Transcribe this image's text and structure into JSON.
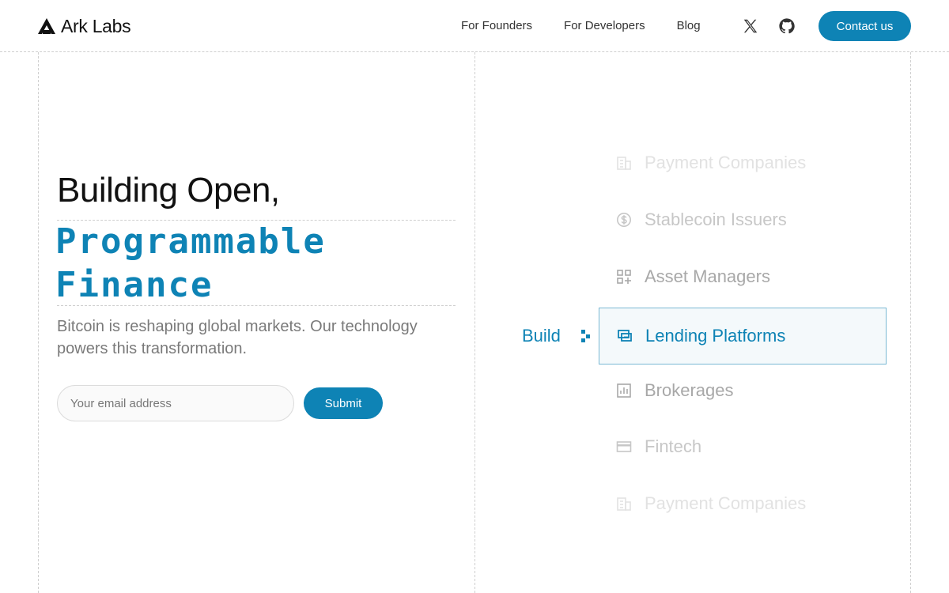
{
  "header": {
    "logo_text": "Ark Labs",
    "nav": [
      "For Founders",
      "For Developers",
      "Blog"
    ],
    "social_icons": [
      "x-twitter-icon",
      "github-icon"
    ],
    "contact_label": "Contact us"
  },
  "hero": {
    "line1": "Building Open,",
    "line2": "Programmable",
    "line3": "Finance",
    "subtitle": "Bitcoin is reshaping global markets. Our technology powers this transformation.",
    "email_placeholder": "Your email address",
    "submit_label": "Submit"
  },
  "carousel": {
    "prefix": "Build",
    "active_index": 3,
    "items": [
      {
        "label": "Payment Companies",
        "icon": "building-icon"
      },
      {
        "label": "Stablecoin Issuers",
        "icon": "dollar-circle-icon"
      },
      {
        "label": "Asset Managers",
        "icon": "grid-plus-icon"
      },
      {
        "label": "Lending Platforms",
        "icon": "cards-icon"
      },
      {
        "label": "Brokerages",
        "icon": "bar-chart-icon"
      },
      {
        "label": "Fintech",
        "icon": "credit-card-icon"
      },
      {
        "label": "Payment Companies",
        "icon": "building-icon"
      }
    ]
  },
  "colors": {
    "accent": "#0e83b5",
    "text": "#111111",
    "muted": "#7a7a7a"
  }
}
